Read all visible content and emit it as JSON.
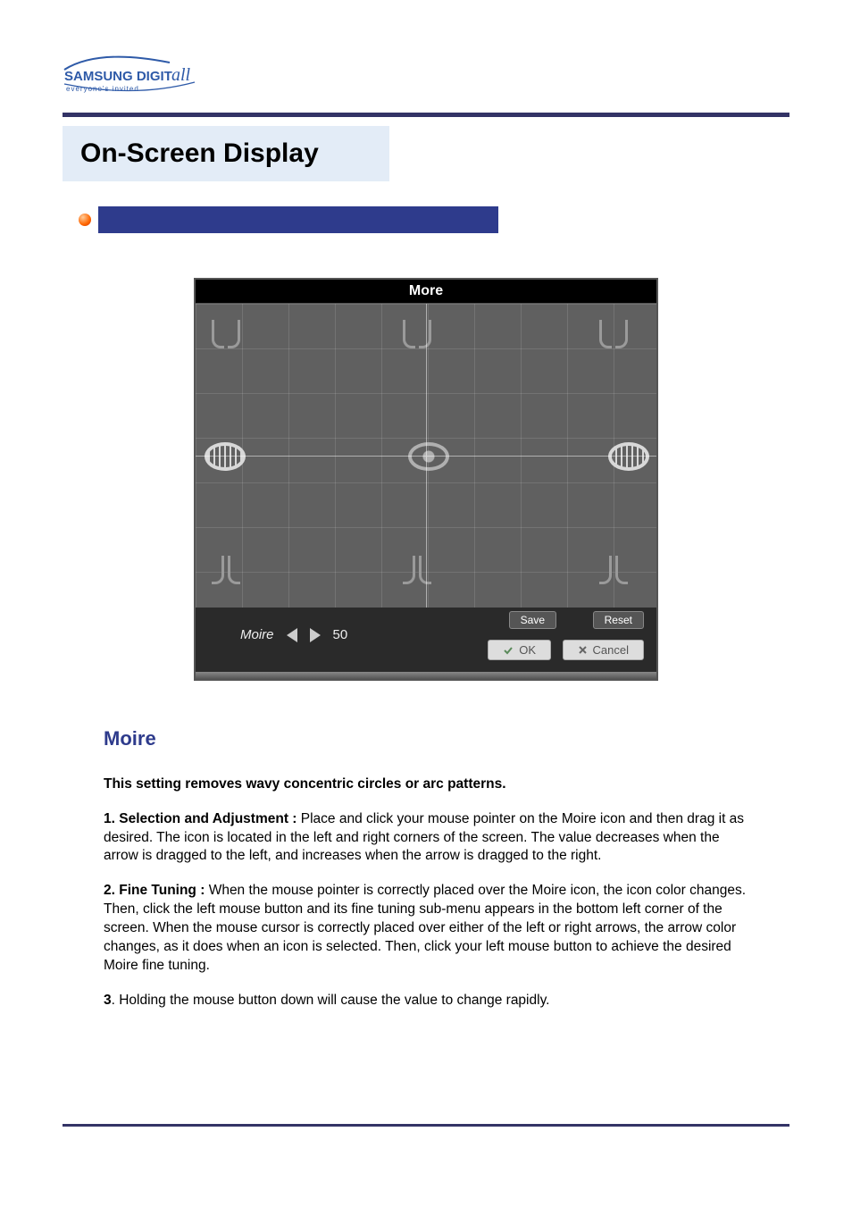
{
  "logo": {
    "brand_line1": "SAMSUNG DIGIT",
    "brand_script": "all",
    "tagline": "everyone's invited"
  },
  "title": "On-Screen Display",
  "osd": {
    "title": "More",
    "param_name": "Moire",
    "param_value": "50",
    "save": "Save",
    "reset": "Reset",
    "ok": "OK",
    "cancel": "Cancel"
  },
  "section": {
    "heading": "Moire",
    "intro": "This setting removes wavy concentric circles or arc patterns.",
    "para1_label": "1. Selection and Adjustment : ",
    "para1": "Place and click your mouse pointer on the Moire icon and then drag it as desired. The icon is located in the left and right corners of the screen. The value decreases when the arrow is dragged to the left, and increases when the arrow is dragged to the right.",
    "para2_label": "2. Fine Tuning : ",
    "para2": "When the mouse pointer is correctly placed over the Moire icon, the icon color changes. Then, click the left mouse button and its fine tuning sub-menu appears in the bottom left corner of the screen. When the mouse cursor is correctly placed over either of the left or right arrows, the arrow color changes, as it does when an icon is selected. Then, click your left mouse button to achieve the desired Moire fine tuning.",
    "para3_label": "3",
    "para3": ". Holding the mouse button down will cause the value to change rapidly."
  }
}
